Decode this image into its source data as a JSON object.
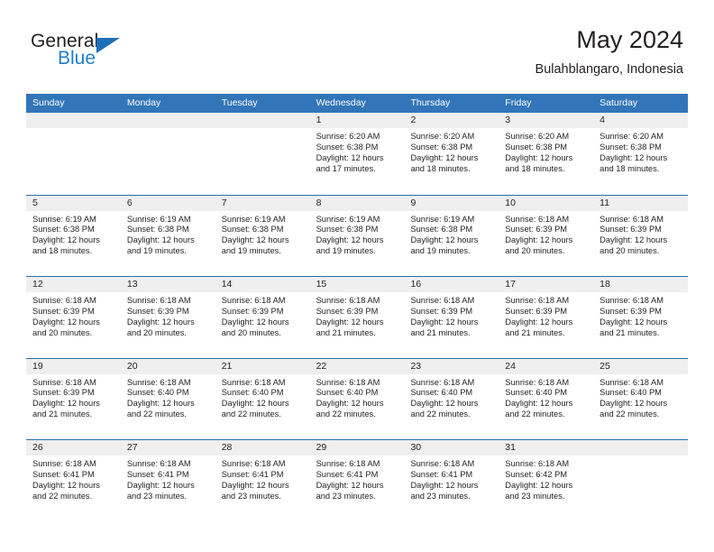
{
  "brand": {
    "word1": "General",
    "word2": "Blue",
    "logo_icon": "triangle-icon"
  },
  "header": {
    "title": "May 2024",
    "subtitle": "Bulahblangaro, Indonesia"
  },
  "colors": {
    "header_blue": "#3275b8",
    "row_rule": "#2e6da4",
    "day_band": "#efefef",
    "brand_blue": "#1f7fc4",
    "text": "#231f20"
  },
  "weekdays": [
    "Sunday",
    "Monday",
    "Tuesday",
    "Wednesday",
    "Thursday",
    "Friday",
    "Saturday"
  ],
  "weeks": [
    [
      {
        "day": "",
        "lines": []
      },
      {
        "day": "",
        "lines": []
      },
      {
        "day": "",
        "lines": []
      },
      {
        "day": "1",
        "lines": [
          "Sunrise: 6:20 AM",
          "Sunset: 6:38 PM",
          "Daylight: 12 hours",
          "and 17 minutes."
        ]
      },
      {
        "day": "2",
        "lines": [
          "Sunrise: 6:20 AM",
          "Sunset: 6:38 PM",
          "Daylight: 12 hours",
          "and 18 minutes."
        ]
      },
      {
        "day": "3",
        "lines": [
          "Sunrise: 6:20 AM",
          "Sunset: 6:38 PM",
          "Daylight: 12 hours",
          "and 18 minutes."
        ]
      },
      {
        "day": "4",
        "lines": [
          "Sunrise: 6:20 AM",
          "Sunset: 6:38 PM",
          "Daylight: 12 hours",
          "and 18 minutes."
        ]
      }
    ],
    [
      {
        "day": "5",
        "lines": [
          "Sunrise: 6:19 AM",
          "Sunset: 6:38 PM",
          "Daylight: 12 hours",
          "and 18 minutes."
        ]
      },
      {
        "day": "6",
        "lines": [
          "Sunrise: 6:19 AM",
          "Sunset: 6:38 PM",
          "Daylight: 12 hours",
          "and 19 minutes."
        ]
      },
      {
        "day": "7",
        "lines": [
          "Sunrise: 6:19 AM",
          "Sunset: 6:38 PM",
          "Daylight: 12 hours",
          "and 19 minutes."
        ]
      },
      {
        "day": "8",
        "lines": [
          "Sunrise: 6:19 AM",
          "Sunset: 6:38 PM",
          "Daylight: 12 hours",
          "and 19 minutes."
        ]
      },
      {
        "day": "9",
        "lines": [
          "Sunrise: 6:19 AM",
          "Sunset: 6:38 PM",
          "Daylight: 12 hours",
          "and 19 minutes."
        ]
      },
      {
        "day": "10",
        "lines": [
          "Sunrise: 6:18 AM",
          "Sunset: 6:39 PM",
          "Daylight: 12 hours",
          "and 20 minutes."
        ]
      },
      {
        "day": "11",
        "lines": [
          "Sunrise: 6:18 AM",
          "Sunset: 6:39 PM",
          "Daylight: 12 hours",
          "and 20 minutes."
        ]
      }
    ],
    [
      {
        "day": "12",
        "lines": [
          "Sunrise: 6:18 AM",
          "Sunset: 6:39 PM",
          "Daylight: 12 hours",
          "and 20 minutes."
        ]
      },
      {
        "day": "13",
        "lines": [
          "Sunrise: 6:18 AM",
          "Sunset: 6:39 PM",
          "Daylight: 12 hours",
          "and 20 minutes."
        ]
      },
      {
        "day": "14",
        "lines": [
          "Sunrise: 6:18 AM",
          "Sunset: 6:39 PM",
          "Daylight: 12 hours",
          "and 20 minutes."
        ]
      },
      {
        "day": "15",
        "lines": [
          "Sunrise: 6:18 AM",
          "Sunset: 6:39 PM",
          "Daylight: 12 hours",
          "and 21 minutes."
        ]
      },
      {
        "day": "16",
        "lines": [
          "Sunrise: 6:18 AM",
          "Sunset: 6:39 PM",
          "Daylight: 12 hours",
          "and 21 minutes."
        ]
      },
      {
        "day": "17",
        "lines": [
          "Sunrise: 6:18 AM",
          "Sunset: 6:39 PM",
          "Daylight: 12 hours",
          "and 21 minutes."
        ]
      },
      {
        "day": "18",
        "lines": [
          "Sunrise: 6:18 AM",
          "Sunset: 6:39 PM",
          "Daylight: 12 hours",
          "and 21 minutes."
        ]
      }
    ],
    [
      {
        "day": "19",
        "lines": [
          "Sunrise: 6:18 AM",
          "Sunset: 6:39 PM",
          "Daylight: 12 hours",
          "and 21 minutes."
        ]
      },
      {
        "day": "20",
        "lines": [
          "Sunrise: 6:18 AM",
          "Sunset: 6:40 PM",
          "Daylight: 12 hours",
          "and 22 minutes."
        ]
      },
      {
        "day": "21",
        "lines": [
          "Sunrise: 6:18 AM",
          "Sunset: 6:40 PM",
          "Daylight: 12 hours",
          "and 22 minutes."
        ]
      },
      {
        "day": "22",
        "lines": [
          "Sunrise: 6:18 AM",
          "Sunset: 6:40 PM",
          "Daylight: 12 hours",
          "and 22 minutes."
        ]
      },
      {
        "day": "23",
        "lines": [
          "Sunrise: 6:18 AM",
          "Sunset: 6:40 PM",
          "Daylight: 12 hours",
          "and 22 minutes."
        ]
      },
      {
        "day": "24",
        "lines": [
          "Sunrise: 6:18 AM",
          "Sunset: 6:40 PM",
          "Daylight: 12 hours",
          "and 22 minutes."
        ]
      },
      {
        "day": "25",
        "lines": [
          "Sunrise: 6:18 AM",
          "Sunset: 6:40 PM",
          "Daylight: 12 hours",
          "and 22 minutes."
        ]
      }
    ],
    [
      {
        "day": "26",
        "lines": [
          "Sunrise: 6:18 AM",
          "Sunset: 6:41 PM",
          "Daylight: 12 hours",
          "and 22 minutes."
        ]
      },
      {
        "day": "27",
        "lines": [
          "Sunrise: 6:18 AM",
          "Sunset: 6:41 PM",
          "Daylight: 12 hours",
          "and 23 minutes."
        ]
      },
      {
        "day": "28",
        "lines": [
          "Sunrise: 6:18 AM",
          "Sunset: 6:41 PM",
          "Daylight: 12 hours",
          "and 23 minutes."
        ]
      },
      {
        "day": "29",
        "lines": [
          "Sunrise: 6:18 AM",
          "Sunset: 6:41 PM",
          "Daylight: 12 hours",
          "and 23 minutes."
        ]
      },
      {
        "day": "30",
        "lines": [
          "Sunrise: 6:18 AM",
          "Sunset: 6:41 PM",
          "Daylight: 12 hours",
          "and 23 minutes."
        ]
      },
      {
        "day": "31",
        "lines": [
          "Sunrise: 6:18 AM",
          "Sunset: 6:42 PM",
          "Daylight: 12 hours",
          "and 23 minutes."
        ]
      },
      {
        "day": "",
        "lines": []
      }
    ]
  ]
}
